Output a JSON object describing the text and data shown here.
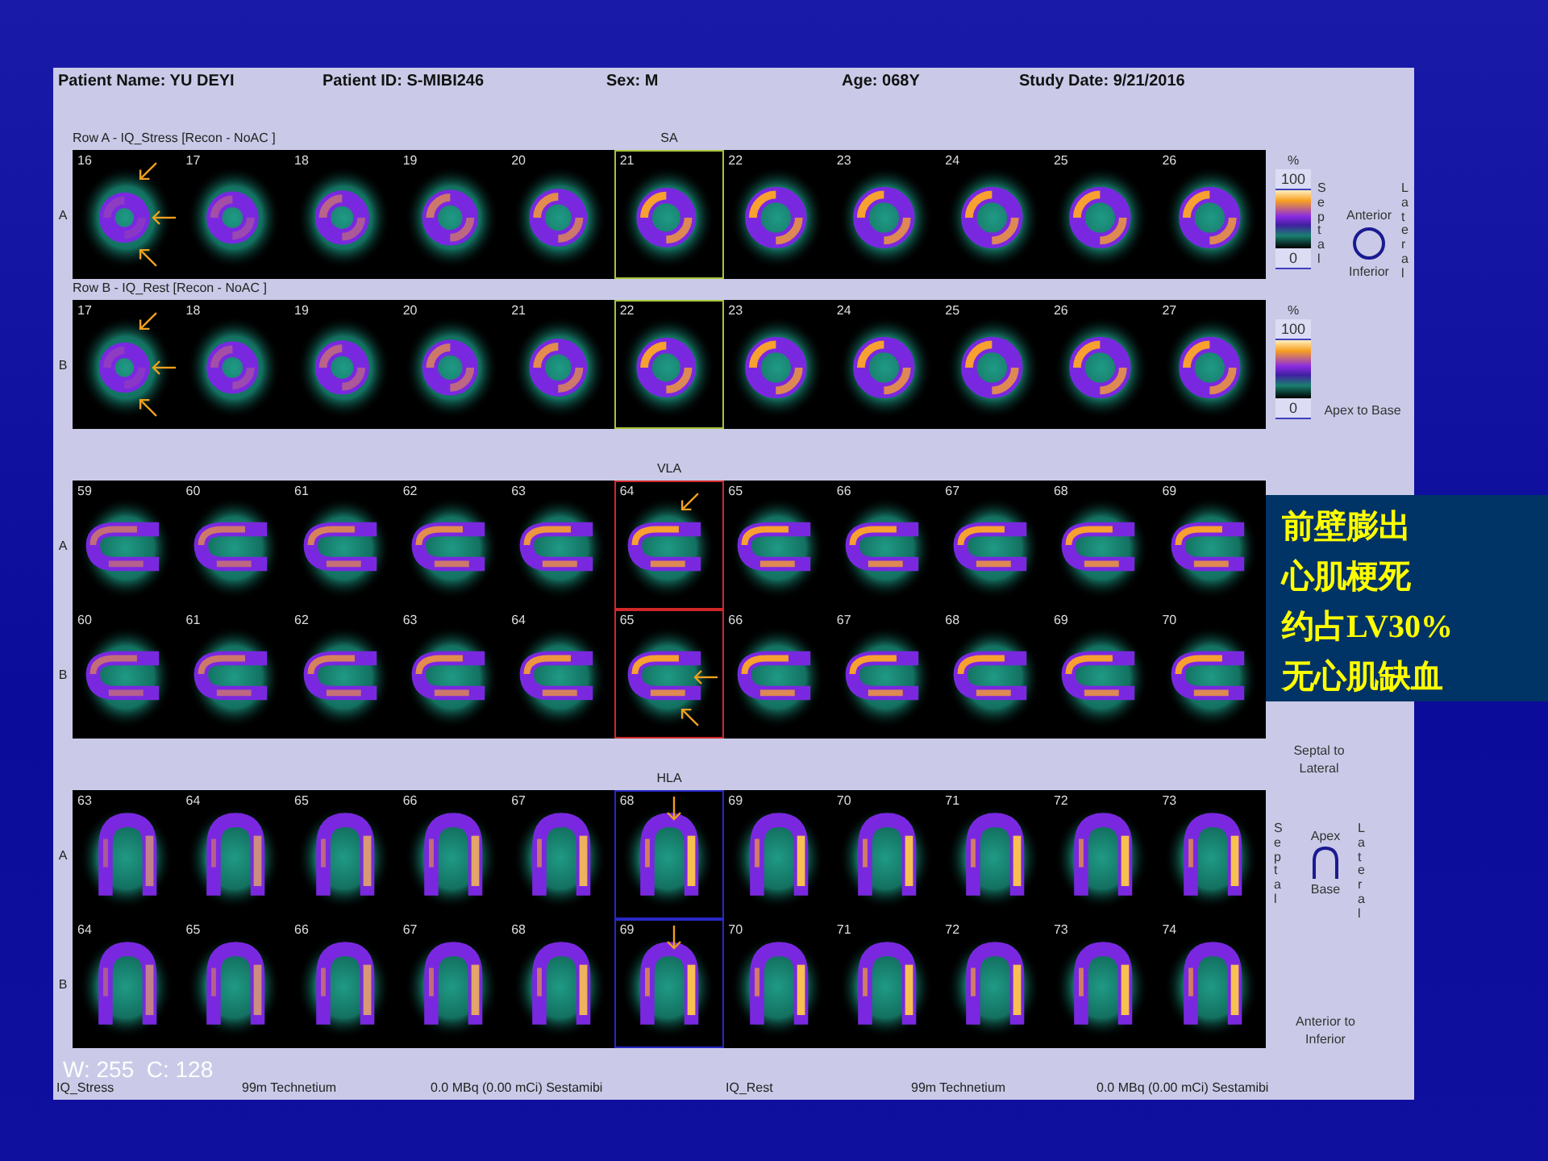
{
  "header": [
    {
      "label": "Patient Name:",
      "value": "YU DEYI"
    },
    {
      "label": "Patient ID:",
      "value": "S-MIBI246"
    },
    {
      "label": "Sex:",
      "value": "M"
    },
    {
      "label": "Age:",
      "value": "068Y"
    },
    {
      "label": "Study Date:",
      "value": "9/21/2016"
    }
  ],
  "sections": [
    {
      "kind": "sa",
      "title": "SA",
      "color": "#a8c43a",
      "strips": [
        {
          "caption": "Row A - IQ_Stress [Recon - NoAC ]",
          "legend": [
            {
              "kind": "scale",
              "unit": "%",
              "max": "100",
              "min": "0"
            },
            {
              "kind": "orientation",
              "left": "Septal",
              "top": "Anterior",
              "bottom": "Inferior",
              "right": "Lateral"
            }
          ],
          "rows": [
            {
              "letter": "A",
              "frames": [
                {
                  "number": "16",
                  "selected": false,
                  "arrows": [
                    {
                      "kind": "sw"
                    },
                    {
                      "kind": "w"
                    },
                    {
                      "kind": "nw"
                    }
                  ]
                },
                {
                  "number": "17",
                  "selected": false
                },
                {
                  "number": "18",
                  "selected": false
                },
                {
                  "number": "19",
                  "selected": false
                },
                {
                  "number": "20",
                  "selected": false
                },
                {
                  "number": "21",
                  "selected": true
                },
                {
                  "number": "22",
                  "selected": false
                },
                {
                  "number": "23",
                  "selected": false
                },
                {
                  "number": "24",
                  "selected": false
                },
                {
                  "number": "25",
                  "selected": false
                },
                {
                  "number": "26",
                  "selected": false
                }
              ]
            }
          ]
        },
        {
          "caption": "Row B - IQ_Rest [Recon - NoAC ]",
          "legend": [
            {
              "kind": "scale",
              "unit": "%",
              "max": "100",
              "min": "0"
            },
            {
              "kind": "caption",
              "text": "Apex to Base"
            }
          ],
          "rows": [
            {
              "letter": "B",
              "frames": [
                {
                  "number": "17",
                  "selected": false,
                  "arrows": [
                    {
                      "kind": "sw"
                    },
                    {
                      "kind": "w"
                    },
                    {
                      "kind": "nw"
                    }
                  ]
                },
                {
                  "number": "18",
                  "selected": false
                },
                {
                  "number": "19",
                  "selected": false
                },
                {
                  "number": "20",
                  "selected": false
                },
                {
                  "number": "21",
                  "selected": false
                },
                {
                  "number": "22",
                  "selected": true
                },
                {
                  "number": "23",
                  "selected": false
                },
                {
                  "number": "24",
                  "selected": false
                },
                {
                  "number": "25",
                  "selected": false
                },
                {
                  "number": "26",
                  "selected": false
                },
                {
                  "number": "27",
                  "selected": false
                }
              ]
            }
          ]
        }
      ]
    },
    {
      "kind": "vla",
      "title": "VLA",
      "color": "#d02828",
      "strips": [
        {
          "legend": [
            {
              "kind": "caption",
              "text": "Septal to Lateral"
            }
          ],
          "rows": [
            {
              "letter": "A",
              "frames": [
                {
                  "number": "59",
                  "selected": false
                },
                {
                  "number": "60",
                  "selected": false
                },
                {
                  "number": "61",
                  "selected": false
                },
                {
                  "number": "62",
                  "selected": false
                },
                {
                  "number": "63",
                  "selected": false
                },
                {
                  "number": "64",
                  "selected": true,
                  "arrows": [
                    {
                      "kind": "sw"
                    }
                  ]
                },
                {
                  "number": "65",
                  "selected": false
                },
                {
                  "number": "66",
                  "selected": false
                },
                {
                  "number": "67",
                  "selected": false
                },
                {
                  "number": "68",
                  "selected": false
                },
                {
                  "number": "69",
                  "selected": false
                }
              ]
            },
            {
              "letter": "B",
              "frames": [
                {
                  "number": "60",
                  "selected": false
                },
                {
                  "number": "61",
                  "selected": false
                },
                {
                  "number": "62",
                  "selected": false
                },
                {
                  "number": "63",
                  "selected": false
                },
                {
                  "number": "64",
                  "selected": false
                },
                {
                  "number": "65",
                  "selected": true,
                  "arrows": [
                    {
                      "kind": "w"
                    },
                    {
                      "kind": "nw"
                    }
                  ]
                },
                {
                  "number": "66",
                  "selected": false
                },
                {
                  "number": "67",
                  "selected": false
                },
                {
                  "number": "68",
                  "selected": false
                },
                {
                  "number": "69",
                  "selected": false
                },
                {
                  "number": "70",
                  "selected": false
                }
              ]
            }
          ]
        }
      ]
    },
    {
      "kind": "hla",
      "title": "HLA",
      "color": "#2828c8",
      "strips": [
        {
          "legend": [
            {
              "kind": "orientation",
              "left": "Septal",
              "top": "Apex",
              "bottom": "Base",
              "right": "Lateral"
            },
            {
              "kind": "caption",
              "text": "Anterior to Inferior"
            }
          ],
          "rows": [
            {
              "letter": "A",
              "frames": [
                {
                  "number": "63",
                  "selected": false
                },
                {
                  "number": "64",
                  "selected": false
                },
                {
                  "number": "65",
                  "selected": false
                },
                {
                  "number": "66",
                  "selected": false
                },
                {
                  "number": "67",
                  "selected": false
                },
                {
                  "number": "68",
                  "selected": true,
                  "arrows": [
                    {
                      "kind": "s"
                    }
                  ]
                },
                {
                  "number": "69",
                  "selected": false
                },
                {
                  "number": "70",
                  "selected": false
                },
                {
                  "number": "71",
                  "selected": false
                },
                {
                  "number": "72",
                  "selected": false
                },
                {
                  "number": "73",
                  "selected": false
                }
              ]
            },
            {
              "letter": "B",
              "frames": [
                {
                  "number": "64",
                  "selected": false
                },
                {
                  "number": "65",
                  "selected": false
                },
                {
                  "number": "66",
                  "selected": false
                },
                {
                  "number": "67",
                  "selected": false
                },
                {
                  "number": "68",
                  "selected": false
                },
                {
                  "number": "69",
                  "selected": true,
                  "arrows": [
                    {
                      "kind": "s"
                    }
                  ]
                },
                {
                  "number": "70",
                  "selected": false
                },
                {
                  "number": "71",
                  "selected": false
                },
                {
                  "number": "72",
                  "selected": false
                },
                {
                  "number": "73",
                  "selected": false
                },
                {
                  "number": "74",
                  "selected": false
                }
              ]
            }
          ]
        }
      ]
    }
  ],
  "window_level": "W: 255  C: 128",
  "footer": [
    "IQ_Stress",
    "99m Technetium",
    "0.0 MBq (0.00 mCi) Sestamibi",
    "IQ_Rest",
    "99m Technetium",
    "0.0 MBq (0.00 mCi) Sestamibi"
  ],
  "annotation": {
    "lines": [
      "前壁膨出",
      "心肌梗死",
      "约占LV30%",
      "无心肌缺血"
    ]
  }
}
